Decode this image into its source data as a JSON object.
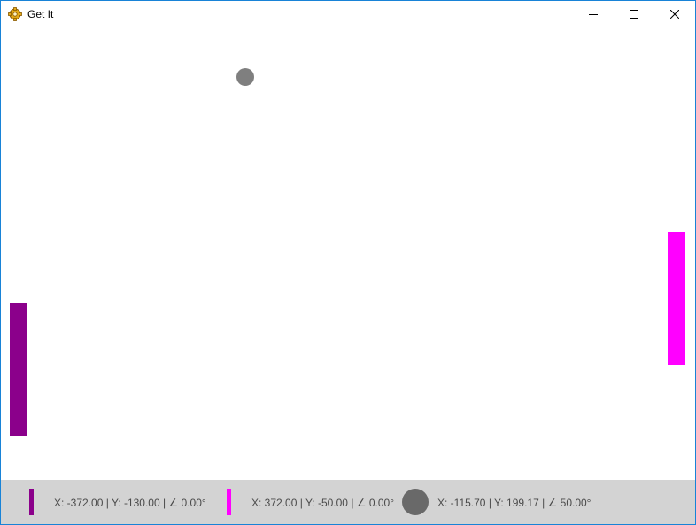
{
  "window": {
    "title": "Get It",
    "controls": {
      "minimize_icon": "minimize-icon",
      "maximize_icon": "maximize-icon",
      "close_icon": "close-icon"
    }
  },
  "game": {
    "ball_color": "#7f7f7f",
    "left_paddle_color": "#8b008b",
    "right_paddle_color": "#ff00ff"
  },
  "status": {
    "left_paddle": "X: -372.00 | Y: -130.00 | ∠ 0.00°",
    "right_paddle": "X: 372.00 | Y: -50.00 | ∠ 0.00°",
    "ball": "X: -115.70 | Y: 199.17 | ∠ 50.00°",
    "ball_swatch_color": "#696969"
  }
}
